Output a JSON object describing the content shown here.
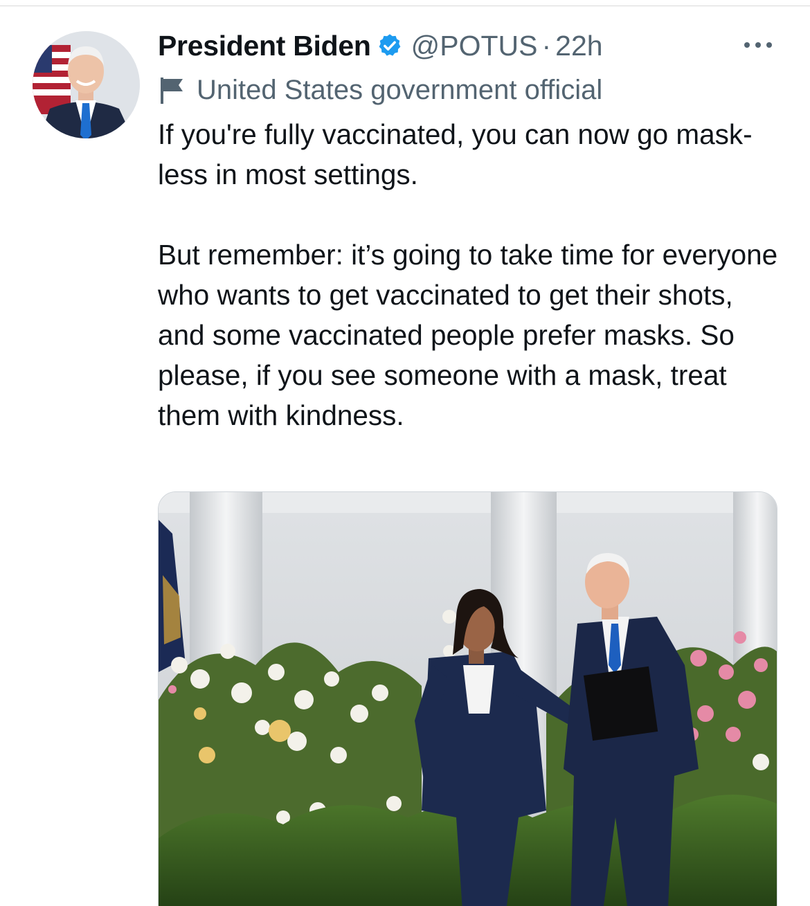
{
  "tweet": {
    "author": {
      "display_name": "President Biden",
      "handle": "@POTUS",
      "verified": true,
      "avatar_icon": "president-portrait-avatar"
    },
    "separator": "·",
    "timestamp": "22h",
    "account_label": "United States government official",
    "account_label_icon": "flag-icon",
    "more_icon": "more-options-icon",
    "paragraphs": [
      "If you're fully vaccinated, you can now go mask-less in most settings.",
      "But remember: it’s going to take time for everyone who wants to get vaccinated to get their shots, and some vaccinated people prefer masks. So please, if you see someone with a mask, treat them with kindness."
    ],
    "media": {
      "type": "photo",
      "icon": "garden-walk-photo"
    }
  },
  "colors": {
    "text_primary": "#0f1419",
    "text_secondary": "#536471",
    "verified_blue": "#1d9bf0",
    "divider": "#d9d9d9"
  }
}
